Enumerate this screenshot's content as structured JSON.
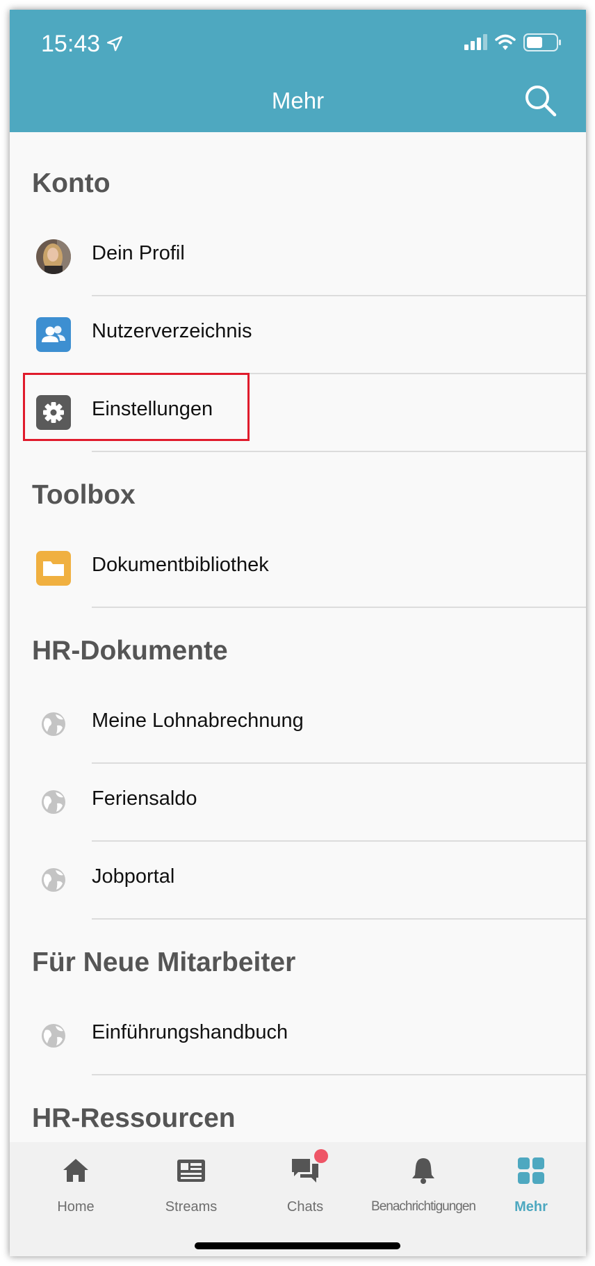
{
  "status_bar": {
    "time": "15:43"
  },
  "header": {
    "title": "Mehr"
  },
  "sections": [
    {
      "title": "Konto",
      "items": [
        {
          "label": "Dein Profil",
          "icon": "avatar"
        },
        {
          "label": "Nutzerverzeichnis",
          "icon": "people-icon"
        },
        {
          "label": "Einstellungen",
          "icon": "gear-icon"
        }
      ]
    },
    {
      "title": "Toolbox",
      "items": [
        {
          "label": "Dokumentbibliothek",
          "icon": "folder-icon"
        }
      ]
    },
    {
      "title": "HR-Dokumente",
      "items": [
        {
          "label": "Meine Lohnabrechnung",
          "icon": "globe-icon"
        },
        {
          "label": "Feriensaldo",
          "icon": "globe-icon"
        },
        {
          "label": "Jobportal",
          "icon": "globe-icon"
        }
      ]
    },
    {
      "title": "Für Neue Mitarbeiter",
      "items": [
        {
          "label": "Einführungshandbuch",
          "icon": "globe-icon"
        }
      ]
    },
    {
      "title": "HR-Ressourcen",
      "items": []
    }
  ],
  "tabs": [
    {
      "label": "Home",
      "icon": "home-icon"
    },
    {
      "label": "Streams",
      "icon": "streams-icon"
    },
    {
      "label": "Chats",
      "icon": "chat-icon"
    },
    {
      "label": "Benachrichtigungen",
      "icon": "bell-icon"
    },
    {
      "label": "Mehr",
      "icon": "grid-icon",
      "active": true
    }
  ],
  "colors": {
    "accent": "#4ea8c0",
    "highlight": "#e01b2c",
    "folder": "#f0b040",
    "people": "#3d8fd1",
    "gear": "#5a5a5a",
    "badge": "#ee5566"
  }
}
